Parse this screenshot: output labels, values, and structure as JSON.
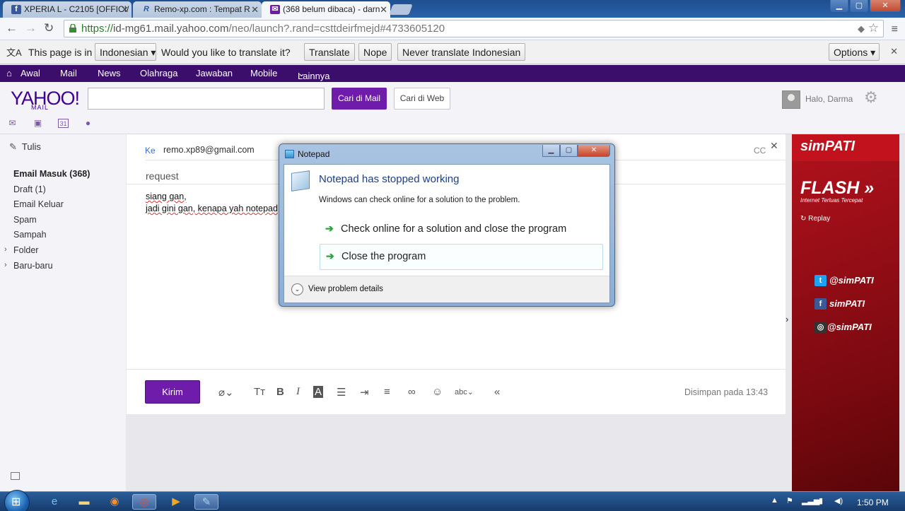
{
  "browser": {
    "tabs": [
      {
        "label": "XPERIA L - C2105 [OFFICI/",
        "icon": "facebook-icon"
      },
      {
        "label": "Remo-xp.com : Tempat R",
        "icon": "remo-icon"
      },
      {
        "label": "(368 belum dibaca) - darn",
        "icon": "mail-icon"
      }
    ],
    "url_scheme": "https://",
    "url_host": "id-mg61.mail.yahoo.com",
    "url_rest": "/neo/launch?.rand=csttdeirfmejd#4733605120"
  },
  "translate_bar": {
    "prompt": "This page is in",
    "language": "Indonesian",
    "question": "Would you like to translate it?",
    "translate": "Translate",
    "nope": "Nope",
    "never": "Never translate Indonesian",
    "options": "Options"
  },
  "yahoo_nav": [
    "Awal",
    "Mail",
    "News",
    "Olahraga",
    "Jawaban",
    "Mobile",
    "Lainnya"
  ],
  "header": {
    "logo": "YAHOO!",
    "logo_sub": "MAIL",
    "search_mail": "Cari di Mail",
    "search_web": "Cari di Web",
    "greeting": "Halo, Darma"
  },
  "sidebar": {
    "compose": "Tulis",
    "folders": [
      {
        "label": "Email Masuk (368)",
        "bold": true
      },
      {
        "label": "Draft (1)"
      },
      {
        "label": "Email Keluar"
      },
      {
        "label": "Spam"
      },
      {
        "label": "Sampah"
      },
      {
        "label": "Folder",
        "expandable": true
      },
      {
        "label": "Baru-baru",
        "expandable": true
      }
    ]
  },
  "compose": {
    "to_label": "Ke",
    "to_value": "remo.xp89@gmail.com",
    "cc_label": "CC",
    "subject": "request",
    "body_lines": [
      "siang gan,",
      "jadi gini gan, kenapa yah notepad"
    ],
    "send": "Kirim",
    "saved": "Disimpan pada 13:43"
  },
  "ad": {
    "brand": "simPATI",
    "headline": "FLASH",
    "tagline": "Internet Terluas Tercepat",
    "replay": "Replay",
    "twitter": "@simPATI",
    "facebook": "simPATI",
    "instagram": "@simPATI"
  },
  "dialog": {
    "title": "Notepad",
    "heading": "Notepad has stopped working",
    "sub": "Windows can check online for a solution to the problem.",
    "option_check": "Check online for a solution and close the program",
    "option_close": "Close the program",
    "details": "View problem details"
  },
  "taskbar": {
    "clock": "1:50 PM"
  },
  "colors": {
    "yahoo_purple": "#400090",
    "button_purple": "#6e1ca9",
    "nav_bar": "#3b0e6b",
    "ad_red": "#b3121c"
  }
}
